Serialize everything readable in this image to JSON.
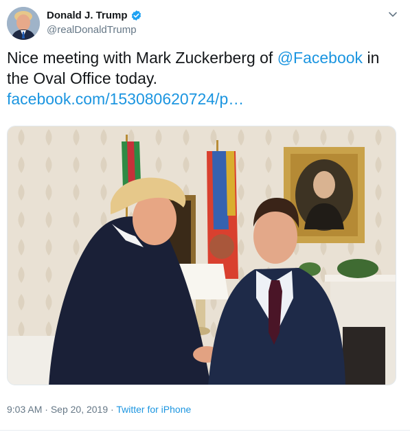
{
  "author": {
    "display_name": "Donald J. Trump",
    "handle": "@realDonaldTrump",
    "verified": true
  },
  "tweet": {
    "text_before": "Nice meeting with Mark Zuckerberg of ",
    "mention": "@Facebook",
    "text_after": " in the Oval Office today.",
    "link": "facebook.com/153080620724/p…"
  },
  "meta": {
    "time": "9:03 AM",
    "date": "Sep 20, 2019",
    "separator": " · ",
    "source": "Twitter for iPhone"
  },
  "icons": {
    "verified": "verified-badge-icon",
    "menu": "chevron-down-icon"
  },
  "colors": {
    "link": "#1b95e0",
    "text": "#14171a",
    "muted": "#657786",
    "verified": "#1da1f2"
  }
}
